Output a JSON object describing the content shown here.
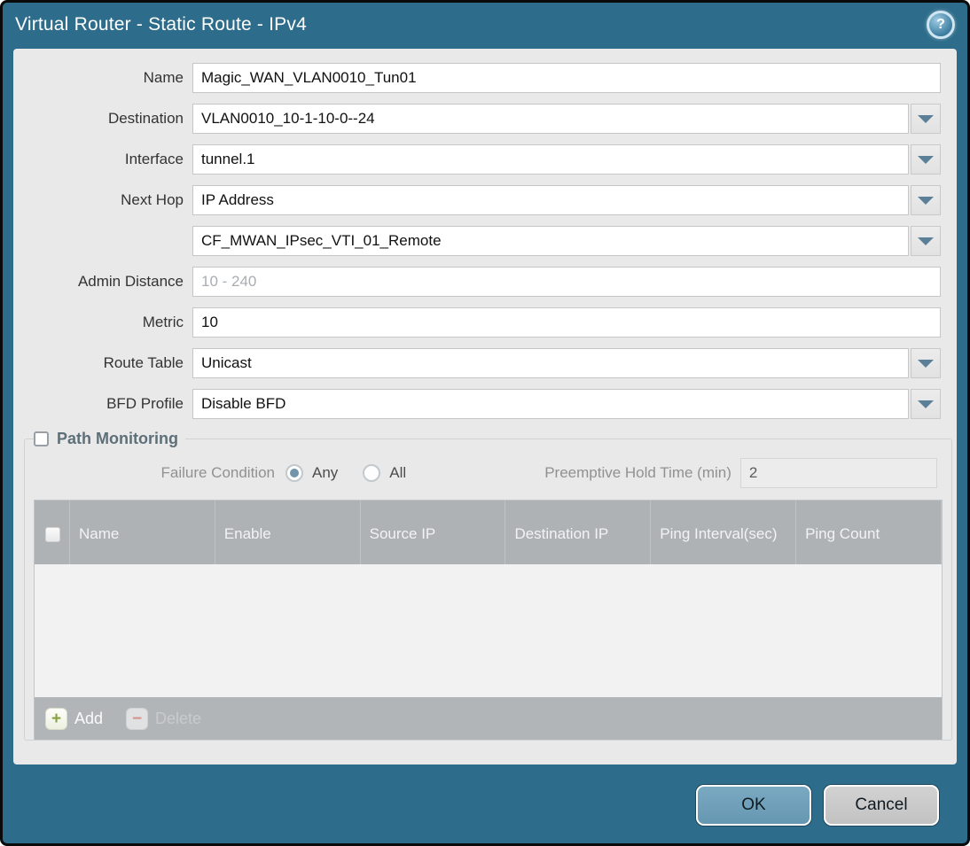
{
  "window": {
    "title": "Virtual Router - Static Route - IPv4"
  },
  "icons": {
    "help": "?",
    "add": "+",
    "delete": "−"
  },
  "form": {
    "name": {
      "label": "Name",
      "value": "Magic_WAN_VLAN0010_Tun01"
    },
    "destination": {
      "label": "Destination",
      "value": "VLAN0010_10-1-10-0--24"
    },
    "interface": {
      "label": "Interface",
      "value": "tunnel.1"
    },
    "next_hop": {
      "label": "Next Hop",
      "value": "IP Address"
    },
    "next_hop_address": {
      "value": "CF_MWAN_IPsec_VTI_01_Remote"
    },
    "admin_distance": {
      "label": "Admin Distance",
      "placeholder": "10 - 240",
      "value": ""
    },
    "metric": {
      "label": "Metric",
      "value": "10"
    },
    "route_table": {
      "label": "Route Table",
      "value": "Unicast"
    },
    "bfd_profile": {
      "label": "BFD Profile",
      "value": "Disable BFD"
    }
  },
  "path_monitoring": {
    "title": "Path Monitoring",
    "enabled": false,
    "failure_condition": {
      "label": "Failure Condition",
      "options": [
        {
          "label": "Any",
          "selected": true
        },
        {
          "label": "All",
          "selected": false
        }
      ]
    },
    "preemptive_hold_time": {
      "label": "Preemptive Hold Time (min)",
      "value": "2"
    },
    "table": {
      "columns": [
        "Name",
        "Enable",
        "Source IP",
        "Destination IP",
        "Ping Interval(sec)",
        "Ping Count"
      ],
      "rows": []
    },
    "toolbar": {
      "add_label": "Add",
      "delete_label": "Delete"
    }
  },
  "footer": {
    "ok_label": "OK",
    "cancel_label": "Cancel"
  },
  "colors": {
    "frame_teal": "#2d6c8a",
    "content_bg": "#e9e9e9",
    "table_header_bg": "#aeb2b5",
    "dropdown_arrow": "#5b7f96",
    "ok_button": "#6fa2bc",
    "cancel_button": "#c9c9c9",
    "add_green": "#85a23c",
    "delete_red": "#d4918f",
    "pm_title": "#5d6f79"
  }
}
